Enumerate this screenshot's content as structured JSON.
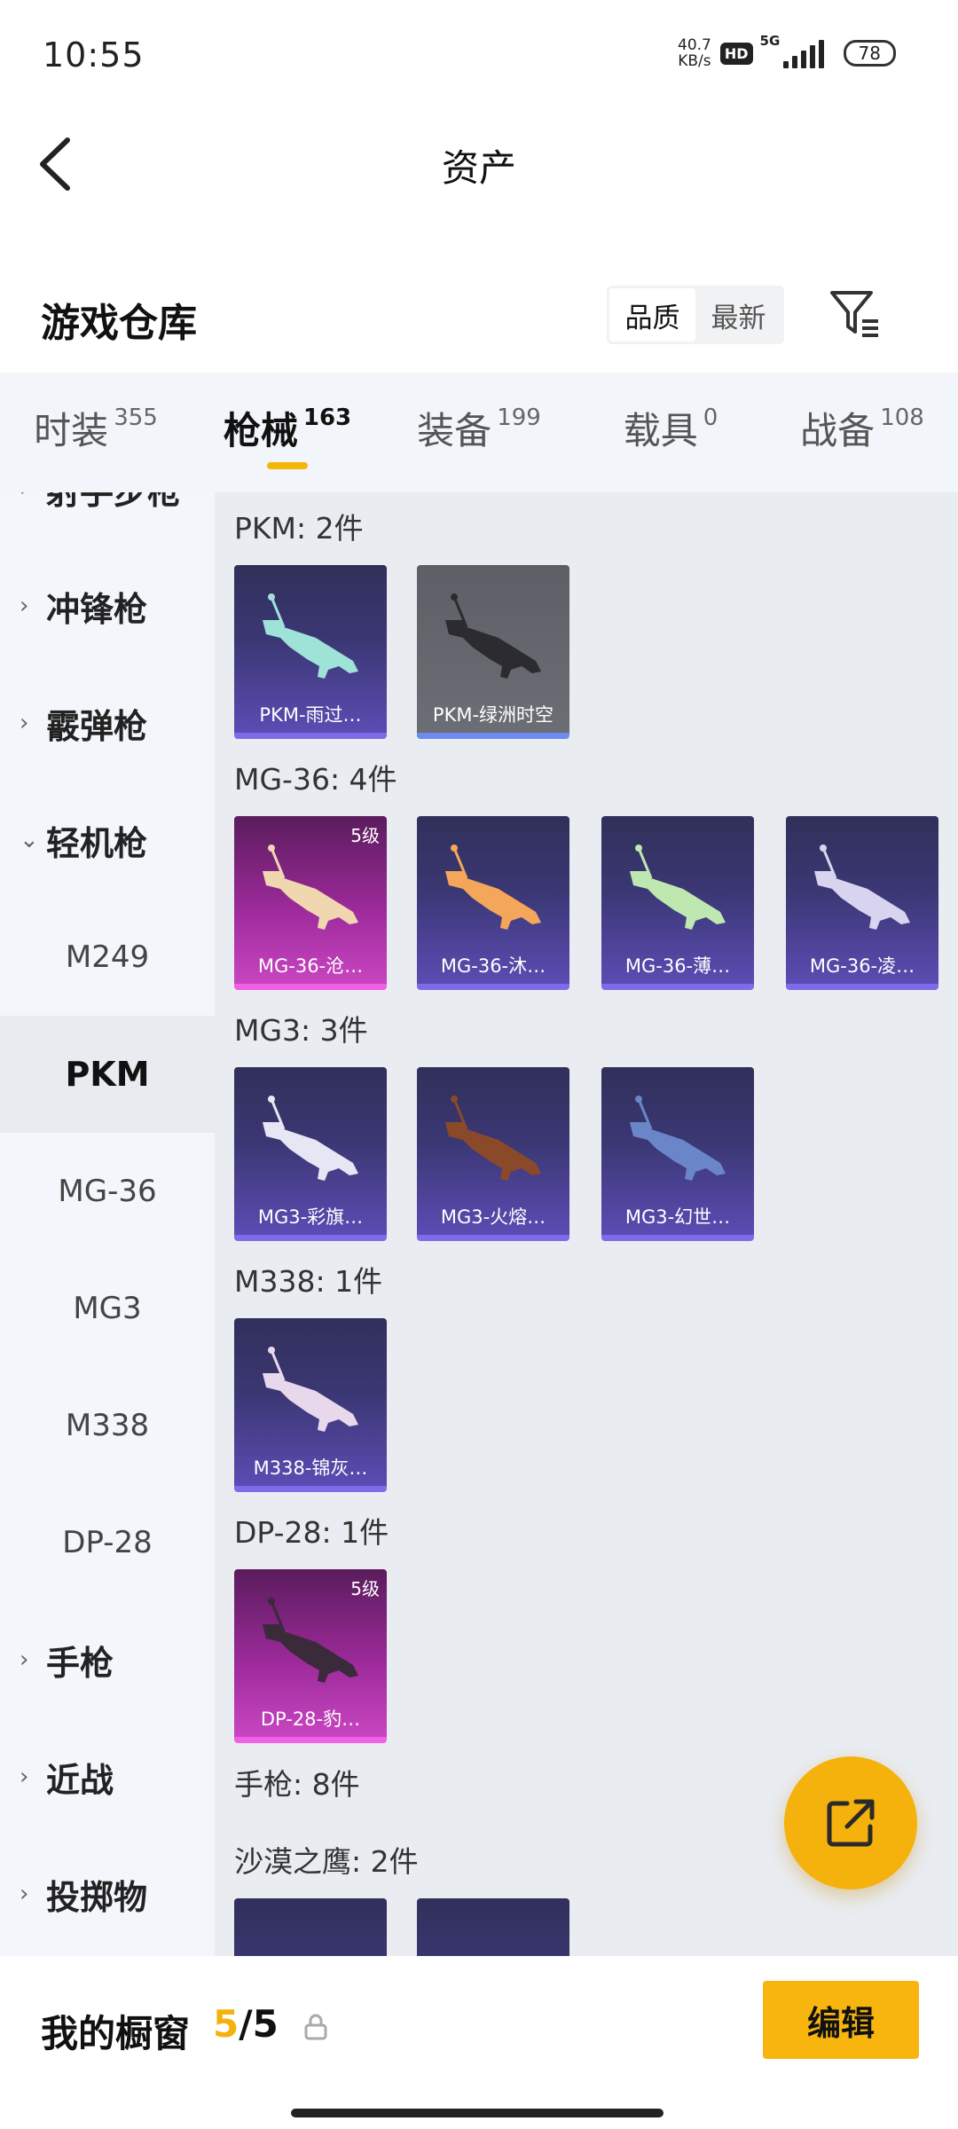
{
  "status": {
    "time": "10:55",
    "speed_value": "40.7",
    "speed_unit": "KB/s",
    "hd": "HD",
    "network": "5G",
    "battery": "78"
  },
  "header": {
    "title": "资产"
  },
  "warehouse": {
    "title": "游戏仓库",
    "sort": [
      "品质",
      "最新"
    ]
  },
  "tabs": [
    {
      "label": "时装",
      "count": "355"
    },
    {
      "label": "枪械",
      "count": "163"
    },
    {
      "label": "装备",
      "count": "199"
    },
    {
      "label": "载具",
      "count": "0"
    },
    {
      "label": "战备",
      "count": "108"
    }
  ],
  "sidebar": {
    "partial_top": "射手步枪",
    "groups": [
      "冲锋枪",
      "霰弹枪",
      "轻机枪",
      "手枪",
      "近战",
      "投掷物"
    ],
    "subs": [
      "M249",
      "PKM",
      "MG-36",
      "MG3",
      "M338",
      "DP-28"
    ]
  },
  "content": {
    "groups": [
      {
        "title": "PKM: 2件",
        "items": [
          "PKM-雨过…",
          "PKM-绿洲时空"
        ]
      },
      {
        "title": "MG-36: 4件",
        "items": [
          "MG-36-沧…",
          "MG-36-沐…",
          "MG-36-薄…",
          "MG-36-凌…"
        ]
      },
      {
        "title": "MG3: 3件",
        "items": [
          "MG3-彩旗…",
          "MG3-火熔…",
          "MG3-幻世…"
        ]
      },
      {
        "title": "M338: 1件",
        "items": [
          "M338-锦灰…"
        ]
      },
      {
        "title": "DP-28: 1件",
        "items": [
          "DP-28-豹…"
        ]
      },
      {
        "title": "手枪: 8件"
      },
      {
        "title": "沙漠之鹰: 2件"
      }
    ],
    "level_badge": "5级"
  },
  "bottom": {
    "my_window": "我的橱窗",
    "current": "5",
    "sep": "/",
    "max": "5",
    "edit": "编辑"
  },
  "colors": {
    "accent": "#f5b10c",
    "purple_card": "#3b3774",
    "pink_card": "#9c2a9a"
  }
}
